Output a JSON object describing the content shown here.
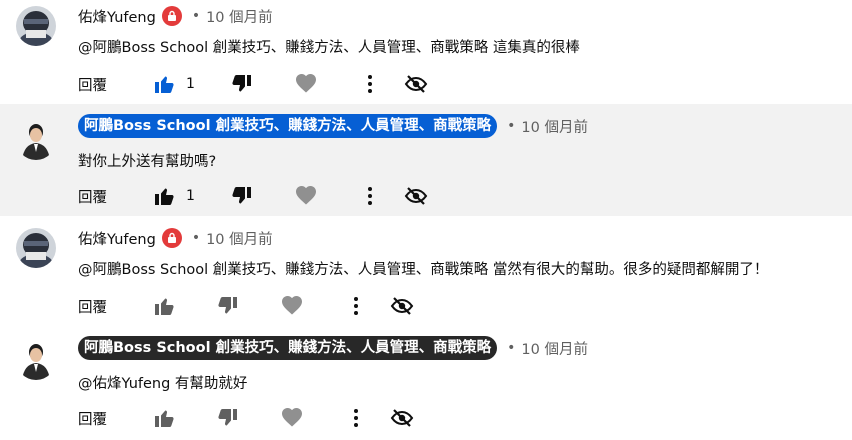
{
  "comments": [
    {
      "author": "佑烽Yufeng",
      "time": "10 個月前",
      "text": "@阿鵬Boss School 創業技巧、賺錢方法、人員管理、商戰策略  這集真的很棒",
      "reply_label": "回覆",
      "like_count": "1",
      "liked": true
    },
    {
      "author": "阿鵬Boss School 創業技巧、賺錢方法、人員管理、商戰策略",
      "bullet": "•",
      "time": "10 個月前",
      "text": "對你上外送有幫助嗎?",
      "reply_label": "回覆",
      "like_count": "1",
      "liked": false
    },
    {
      "author": "佑烽Yufeng",
      "time": "10 個月前",
      "text": "@阿鵬Boss School 創業技巧、賺錢方法、人員管理、商戰策略  當然有很大的幫助。很多的疑問都解開了！",
      "reply_label": "回覆",
      "liked": false
    },
    {
      "author": "阿鵬Boss School 創業技巧、賺錢方法、人員管理、商戰策略",
      "bullet": "•",
      "time": "10 個月前",
      "text": "@佑烽Yufeng  有幫助就好",
      "reply_label": "回覆",
      "liked": false
    }
  ],
  "icons": {
    "like": "thumbs-up-icon",
    "dislike": "thumbs-down-icon",
    "heart": "heart-icon",
    "more": "more-vert-icon",
    "hide": "eye-off-icon",
    "badge": "lock-icon"
  },
  "colors": {
    "liked_blue": "#065fd4",
    "owner_badge_blue": "#065fd4",
    "owner_badge_dark": "#282828",
    "red_badge": "#e33b3b",
    "highlight_bg": "#f2f2f2"
  }
}
